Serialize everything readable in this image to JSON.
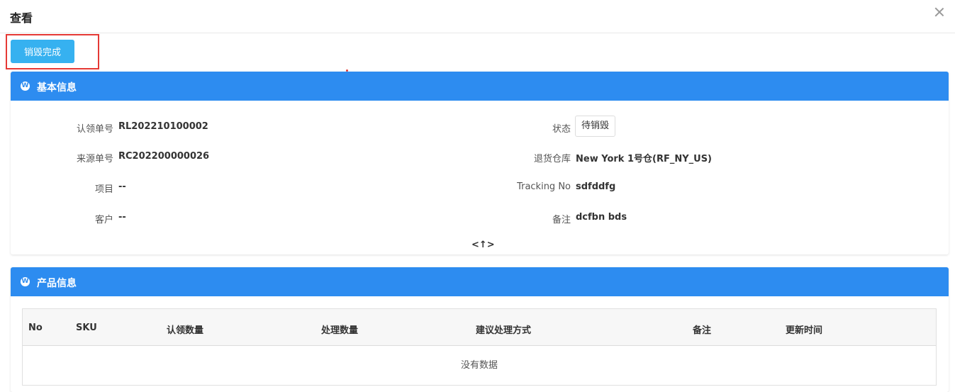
{
  "modal": {
    "title": "查看"
  },
  "actions": {
    "destroy_complete_label": "销毁完成"
  },
  "basic_info": {
    "title": "基本信息",
    "fields": {
      "claim_no": {
        "label": "认领单号",
        "value": "RL202210100002"
      },
      "source_no": {
        "label": "来源单号",
        "value": "RC202200000026"
      },
      "project": {
        "label": "项目",
        "value": "--"
      },
      "customer": {
        "label": "客户",
        "value": "--"
      },
      "status": {
        "label": "状态",
        "value": "待销毁"
      },
      "return_warehouse": {
        "label": "退货仓库",
        "value": "New York 1号仓(RF_NY_US)"
      },
      "tracking_no": {
        "label": "Tracking No",
        "value": "sdfddfg"
      },
      "remark": {
        "label": "备注",
        "value": "dcfbn bds"
      }
    },
    "collapse_toggle": "<↑>"
  },
  "product_info": {
    "title": "产品信息",
    "columns": [
      "No",
      "SKU",
      "认领数量",
      "处理数量",
      "建议处理方式",
      "备注",
      "更新时间"
    ],
    "empty_text": "没有数据"
  },
  "colors": {
    "panel_header": "#2d8cf0",
    "primary_button": "#36b1f0",
    "highlight": "#e53935"
  }
}
